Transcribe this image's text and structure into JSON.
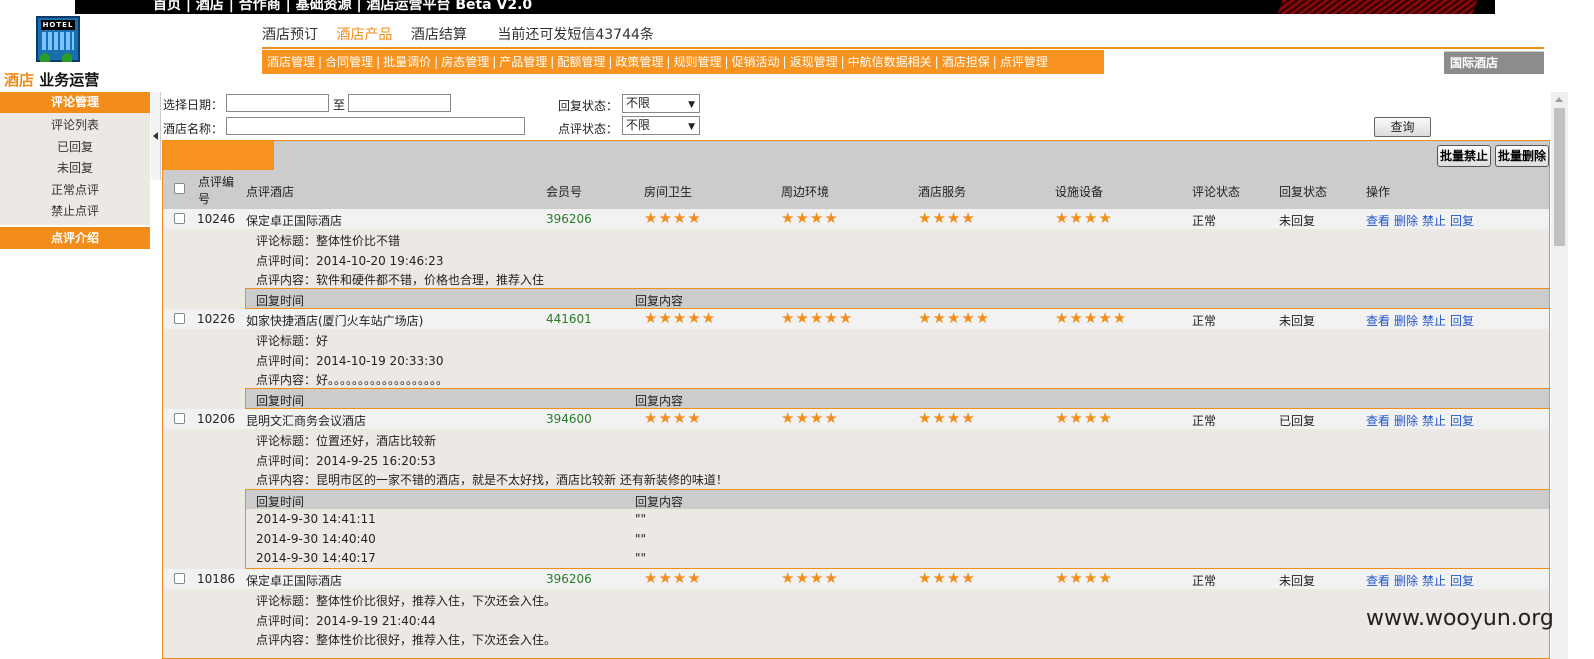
{
  "top_links": "首页 | 酒店 | 合作商 | 基础资源 | 酒店运营平台 Beta V2.0",
  "logo": {
    "sign": "HOTEL",
    "brand_orange": "酒店",
    "brand_black": "业务运营"
  },
  "subnav": {
    "items": [
      "酒店预订",
      "酒店产品",
      "酒店结算"
    ],
    "active_index": 1,
    "sms": "当前还可发短信43744条"
  },
  "menu": [
    "酒店管理",
    "合同管理",
    "批量调价",
    "房态管理",
    "产品管理",
    "配额管理",
    "政策管理",
    "规则管理",
    "促销活动",
    "返现管理",
    "中航信数据相关",
    "酒店担保",
    "点评管理"
  ],
  "intl_label": "国际酒店",
  "sidebar": {
    "section1": "评论管理",
    "items": [
      "评论列表",
      "已回复",
      "未回复",
      "正常点评",
      "禁止点评"
    ],
    "section2": "点评介绍"
  },
  "filter": {
    "date_label": "选择日期：",
    "to_label": "至",
    "name_label": "酒店名称：",
    "reply_status_label": "回复状态：",
    "reply_status_value": "不限",
    "review_status_label": "点评状态：",
    "review_status_value": "不限",
    "query_button": "查询"
  },
  "batch": {
    "ban": "批量禁止",
    "delete": "批量删除"
  },
  "table": {
    "headers": {
      "id_line1": "点评编",
      "id_line2": "号",
      "hotel": "点评酒店",
      "member": "会员号",
      "room": "房间卫生",
      "env": "周边环境",
      "service": "酒店服务",
      "facility": "设施设备",
      "review_status": "评论状态",
      "reply_status": "回复状态",
      "ops": "操作"
    },
    "ops": [
      "查看",
      "删除",
      "禁止",
      "回复"
    ],
    "reply_head": {
      "time": "回复时间",
      "content": "回复内容"
    },
    "rows": [
      {
        "id": "10246",
        "hotel": "保定卓正国际酒店",
        "member": "396206",
        "room": 4,
        "env": 4,
        "service": 4,
        "facility": 4,
        "status": "正常",
        "reply_status": "未回复",
        "title": "评论标题：整体性价比不错",
        "time": "点评时间：2014-10-20 19:46:23",
        "content": "点评内容：软件和硬件都不错，价格也合理，推荐入住"
      },
      {
        "id": "10226",
        "hotel": "如家快捷酒店(厦门火车站广场店)",
        "member": "441601",
        "room": 5,
        "env": 5,
        "service": 5,
        "facility": 5,
        "status": "正常",
        "reply_status": "未回复",
        "title": "评论标题：好",
        "time": "点评时间：2014-10-19 20:33:30",
        "content": "点评内容：好。。。。。。。。。。。。。。。。。。。"
      },
      {
        "id": "10206",
        "hotel": "昆明文汇商务会议酒店",
        "member": "394600",
        "room": 4,
        "env": 4,
        "service": 4,
        "facility": 4,
        "status": "正常",
        "reply_status": "已回复",
        "title": "评论标题：位置还好，酒店比较新",
        "time": "点评时间：2014-9-25 16:20:53",
        "content": "点评内容：昆明市区的一家不错的酒店，就是不太好找，酒店比较新 还有新装修的味道！",
        "replies": [
          {
            "time": "2014-9-30 14:41:11",
            "content": "\"\""
          },
          {
            "time": "2014-9-30 14:40:40",
            "content": "\"\""
          },
          {
            "time": "2014-9-30 14:40:17",
            "content": "\"\""
          }
        ]
      },
      {
        "id": "10186",
        "hotel": "保定卓正国际酒店",
        "member": "396206",
        "room": 4,
        "env": 4,
        "service": 4,
        "facility": 4,
        "status": "正常",
        "reply_status": "未回复",
        "title": "评论标题：整体性价比很好，推荐入住，下次还会入住。",
        "time": "点评时间：2014-9-19 21:40:44",
        "content": "点评内容：整体性价比很好，推荐入住，下次还会入住。"
      }
    ]
  },
  "watermark": "www.wooyun.org"
}
